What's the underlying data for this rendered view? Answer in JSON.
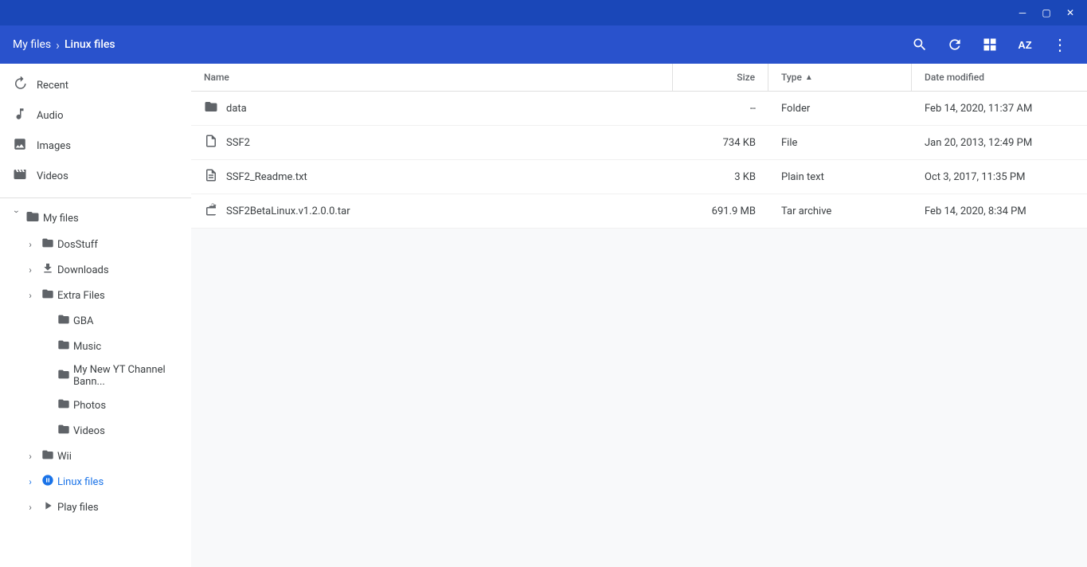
{
  "titlebar": {
    "minimize_label": "─",
    "maximize_label": "▢",
    "close_label": "✕"
  },
  "header": {
    "breadcrumb_parent": "My files",
    "breadcrumb_sep": "›",
    "breadcrumb_current": "Linux files",
    "search_icon": "🔍",
    "refresh_icon": "↻",
    "grid_icon": "⊞",
    "sort_icon": "AZ",
    "menu_icon": "⋮"
  },
  "sidebar": {
    "top_items": [
      {
        "id": "recent",
        "label": "Recent",
        "icon": "🕐"
      },
      {
        "id": "audio",
        "label": "Audio",
        "icon": "🎵"
      },
      {
        "id": "images",
        "label": "Images",
        "icon": "🖼"
      },
      {
        "id": "videos",
        "label": "Videos",
        "icon": "🎬"
      }
    ],
    "my_files_label": "My files",
    "tree": [
      {
        "id": "dosstuff",
        "label": "DosStuff",
        "indent": 1,
        "hasChevron": true,
        "expanded": false
      },
      {
        "id": "downloads",
        "label": "Downloads",
        "indent": 1,
        "hasChevron": true,
        "expanded": false
      },
      {
        "id": "extra-files",
        "label": "Extra Files",
        "indent": 1,
        "hasChevron": true,
        "expanded": false
      },
      {
        "id": "gba",
        "label": "GBA",
        "indent": 2,
        "hasChevron": false,
        "expanded": false
      },
      {
        "id": "music",
        "label": "Music",
        "indent": 2,
        "hasChevron": false,
        "expanded": false
      },
      {
        "id": "my-new-yt",
        "label": "My New YT Channel Bann...",
        "indent": 2,
        "hasChevron": false,
        "expanded": false
      },
      {
        "id": "photos",
        "label": "Photos",
        "indent": 2,
        "hasChevron": false,
        "expanded": false
      },
      {
        "id": "videos2",
        "label": "Videos",
        "indent": 2,
        "hasChevron": false,
        "expanded": false
      },
      {
        "id": "wii",
        "label": "Wii",
        "indent": 1,
        "hasChevron": true,
        "expanded": false
      },
      {
        "id": "linux-files",
        "label": "Linux files",
        "indent": 1,
        "hasChevron": true,
        "expanded": false,
        "active": true,
        "special": true
      },
      {
        "id": "play-files",
        "label": "Play files",
        "indent": 1,
        "hasChevron": false,
        "expanded": false,
        "play": true
      }
    ]
  },
  "table": {
    "columns": [
      {
        "id": "name",
        "label": "Name"
      },
      {
        "id": "size",
        "label": "Size"
      },
      {
        "id": "type",
        "label": "Type",
        "sortActive": true,
        "sortDir": "asc"
      },
      {
        "id": "date",
        "label": "Date modified"
      }
    ],
    "rows": [
      {
        "id": "data",
        "name": "data",
        "size": "--",
        "type": "Folder",
        "date": "Feb 14, 2020, 11:37 AM",
        "icon": "folder"
      },
      {
        "id": "ssf2",
        "name": "SSF2",
        "size": "734 KB",
        "type": "File",
        "date": "Jan 20, 2013, 12:49 PM",
        "icon": "file"
      },
      {
        "id": "ssf2-readme",
        "name": "SSF2_Readme.txt",
        "size": "3 KB",
        "type": "Plain text",
        "date": "Oct 3, 2017, 11:35 PM",
        "icon": "file"
      },
      {
        "id": "ssf2-tar",
        "name": "SSF2BetaLinux.v1.2.0.0.tar",
        "size": "691.9 MB",
        "type": "Tar archive",
        "date": "Feb 14, 2020, 8:34 PM",
        "icon": "archive"
      }
    ]
  }
}
